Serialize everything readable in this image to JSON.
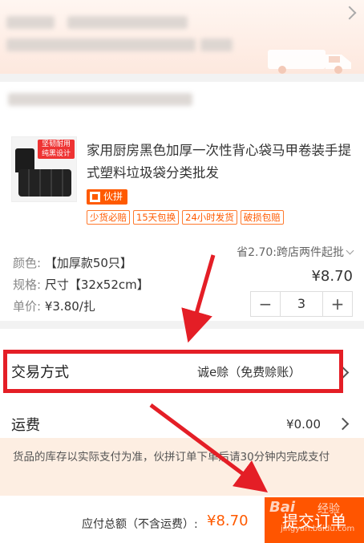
{
  "product": {
    "title": "家用厨房黑色加厚一次性背心袋马甲卷装手提式塑料垃圾袋分类批发",
    "image_badge_lines": [
      "坚韧耐用",
      "纯黑设计"
    ],
    "promo_tag": "伙拼",
    "service_tags": [
      "少货必赔",
      "15天包换",
      "24小时发货",
      "破损包赔"
    ],
    "specs": [
      {
        "label": "颜色:",
        "value": "【加厚款50只】"
      },
      {
        "label": "规格:",
        "value": "尺寸【32x52cm】"
      },
      {
        "label": "单价:",
        "value": "¥3.80/扎"
      }
    ],
    "savings_text": "省2.70:跨店两件起批",
    "price": "¥8.70",
    "quantity": "3",
    "minus": "−",
    "plus": "+"
  },
  "trade": {
    "label": "交易方式",
    "value": "诚e赊（免费赊账）"
  },
  "shipping": {
    "label": "运费",
    "value": "¥0.00"
  },
  "notice": {
    "text": "货品的库存以实际支付为准，伙拼订单下单后请30分钟内完成支付"
  },
  "footer": {
    "total_label": "应付总额（不含运费）:",
    "total_value": "¥8.70",
    "submit_label": "提交订单"
  },
  "watermark": {
    "brand": "Bai",
    "site": "经验",
    "url": "jingyan.baidu.com"
  },
  "colors": {
    "accent": "#ff5500",
    "annotation_red": "#e41e26"
  },
  "icons": [
    "chevron-right-icon",
    "truck-icon",
    "chevron-down-icon"
  ]
}
